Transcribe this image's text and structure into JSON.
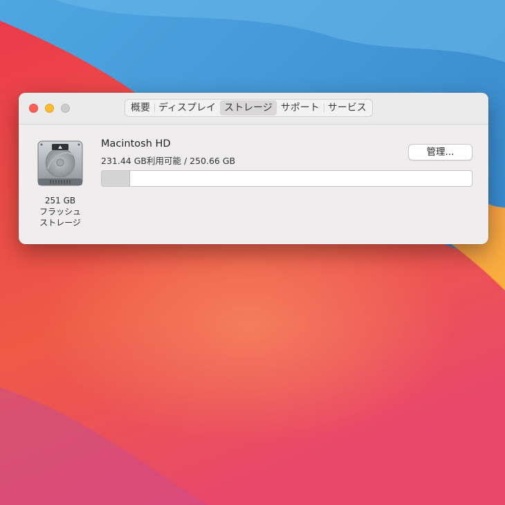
{
  "window": {
    "tabs": [
      {
        "label": "概要",
        "active": false
      },
      {
        "label": "ディスプレイ",
        "active": false
      },
      {
        "label": "ストレージ",
        "active": true
      },
      {
        "label": "サポート",
        "active": false
      },
      {
        "label": "サービス",
        "active": false
      }
    ]
  },
  "storage": {
    "disk_icon": "hard-drive-icon",
    "disk_caption": [
      "251 GB",
      "フラッシュ",
      "ストレージ"
    ],
    "volume_name": "Macintosh HD",
    "volume_info": "231.44 GB利用可能 / 250.66 GB",
    "manage_label": "管理...",
    "used_fraction": 0.077
  },
  "colors": {
    "close": "#fe5f57",
    "minimize": "#febc2e",
    "zoom_disabled": "#cdcbcc",
    "window_bg": "#efedee"
  }
}
